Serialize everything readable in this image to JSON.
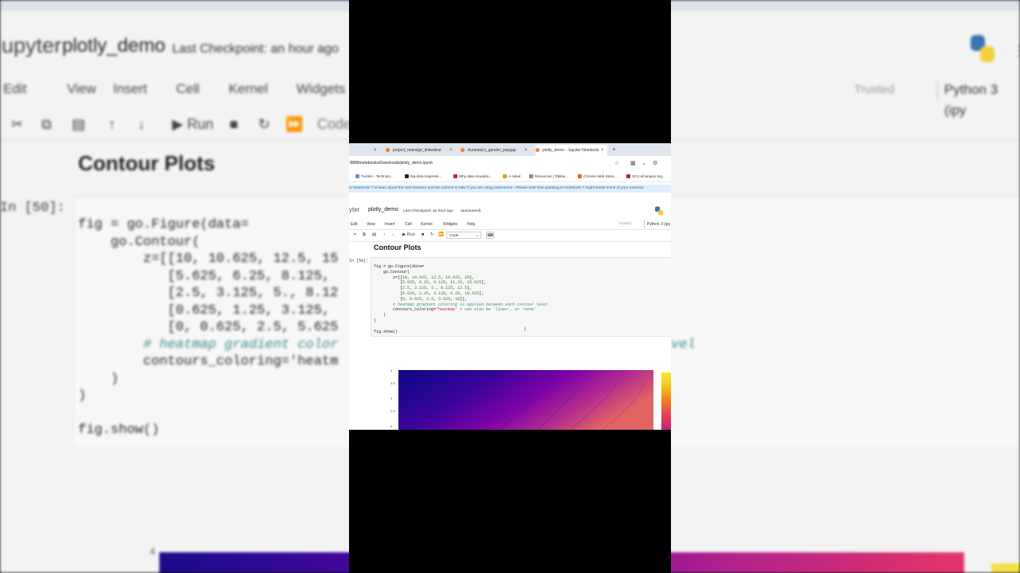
{
  "background": {
    "logo_text": "jupyter",
    "notebook_name": "plotly_demo",
    "checkpoint": "Last Checkpoint: an hour ago",
    "menu": [
      "Edit",
      "View",
      "Insert",
      "Cell",
      "Kernel",
      "Widgets"
    ],
    "trusted": "Trusted",
    "kernel": "Python 3 (ipy",
    "toolbar_run": "Run",
    "toolbar_celltype": "Code",
    "heading": "Contour Plots",
    "prompt": "In [50]:",
    "code_lines": [
      "fig = go.Figure(data=",
      "    go.Contour(",
      "        z=[[10, 10.625, 12.5, 15",
      "           [5.625, 6.25, 8.125,",
      "           [2.5, 3.125, 5., 8.12",
      "           [0.625, 1.25, 3.125,",
      "           [0, 0.625, 2.5, 5.625",
      "        # heatmap gradient color",
      "        contours_coloring='heatm",
      "    )",
      ")",
      "",
      "fig.show()"
    ],
    "right_comment": "vel",
    "plot_tick": "4"
  },
  "browser": {
    "tabs": [
      {
        "label": "project_redesign_linkedinst",
        "active": false
      },
      {
        "label": "Australia's_gender_paygap",
        "active": false
      },
      {
        "label": "plotly_demo - Jupyter Notebook",
        "active": true
      }
    ],
    "new_tab": "+",
    "url": ":8889/notebooks/Downloads/plotly_demo.ipynb",
    "bookmarks": [
      {
        "label": "Turnitin - Technolo...",
        "color": "#5b8fd8"
      },
      {
        "label": "big-data-mapredu...",
        "color": "#222222"
      },
      {
        "label": "Why data visualiza...",
        "color": "#c0272d"
      },
      {
        "label": "A Adeel",
        "color": "#d4a017"
      },
      {
        "label": "Resources | Tablea...",
        "color": "#888888"
      },
      {
        "label": "Chrome Web Store...",
        "color": "#e0632b"
      },
      {
        "label": "SCU eCampus Sig...",
        "color": "#b3252b"
      }
    ]
  },
  "notebook": {
    "notice": "to Notebook 7 to learn about the new features and the actions to take if you are using extensions - Please note that updating to Notebook 7 might break some of your extensio",
    "logo_text": "yter",
    "name": "plotly_demo",
    "checkpoint": "Last Checkpoint: an hour ago",
    "autosaved": "(autosaved)",
    "menu": [
      "Edit",
      "View",
      "Insert",
      "Cell",
      "Kernel",
      "Widgets",
      "Help"
    ],
    "trusted": "Trusted",
    "kernel": "Python 3 (ipy",
    "toolbar": {
      "run": "Run",
      "cell_type": "Code"
    },
    "heading": "Contour Plots",
    "prompt": "In [50]:",
    "plot_yticks": [
      "4",
      "3.5",
      "3",
      "2.5",
      "2"
    ]
  },
  "colors": {
    "tab_bar": "#dfe5ec",
    "notice_bg": "#dfeefb",
    "contour_low": "#0d0887",
    "contour_high": "#f0f921"
  }
}
